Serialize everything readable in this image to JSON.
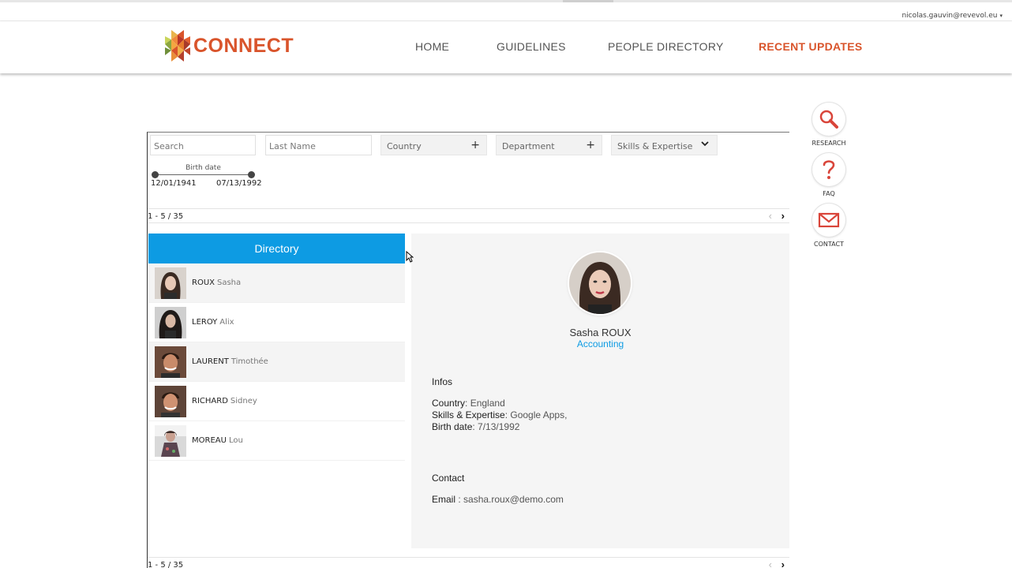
{
  "account": {
    "email": "nicolas.gauvin@revevol.eu",
    "caret": "▾"
  },
  "brand": {
    "name": "CONNECT"
  },
  "nav": [
    {
      "label": "HOME"
    },
    {
      "label": "GUIDELINES"
    },
    {
      "label": "PEOPLE DIRECTORY"
    },
    {
      "label": "RECENT UPDATES",
      "active": true
    }
  ],
  "side_icons": [
    {
      "label": "RESEARCH",
      "icon": "magnifier-icon"
    },
    {
      "label": "FAQ",
      "icon": "question-icon"
    },
    {
      "label": "CONTACT",
      "icon": "envelope-icon"
    }
  ],
  "filters": {
    "search_placeholder": "Search",
    "lastname_placeholder": "Last Name",
    "country_label": "Country",
    "department_label": "Department",
    "skills_label": "Skills & Expertise",
    "plus_glyph": "+",
    "birth_date": {
      "title": "Birth date",
      "from": "12/01/1941",
      "to": "07/13/1992"
    }
  },
  "pager": {
    "range": "1 - 5 / 35",
    "prev": "‹",
    "next": "›"
  },
  "directory": {
    "title": "Directory",
    "people": [
      {
        "last": "ROUX",
        "first": "Sasha"
      },
      {
        "last": "LEROY",
        "first": "Alix"
      },
      {
        "last": "LAURENT",
        "first": "Timothée"
      },
      {
        "last": "RICHARD",
        "first": "Sidney"
      },
      {
        "last": "MOREAU",
        "first": "Lou"
      }
    ]
  },
  "detail": {
    "name": "Sasha ROUX",
    "department": "Accounting",
    "infos_title": "Infos",
    "country_key": "Country",
    "country_value": ": England",
    "skills_key": "Skills & Expertise",
    "skills_value": ": Google Apps,",
    "birth_key": "Birth date",
    "birth_value": ": 7/13/1992",
    "contact_title": "Contact",
    "email_key": "Email",
    "email_value": " : sasha.roux@demo.com"
  },
  "colors": {
    "brand": "#d9542b",
    "accent": "#0d9be3"
  }
}
